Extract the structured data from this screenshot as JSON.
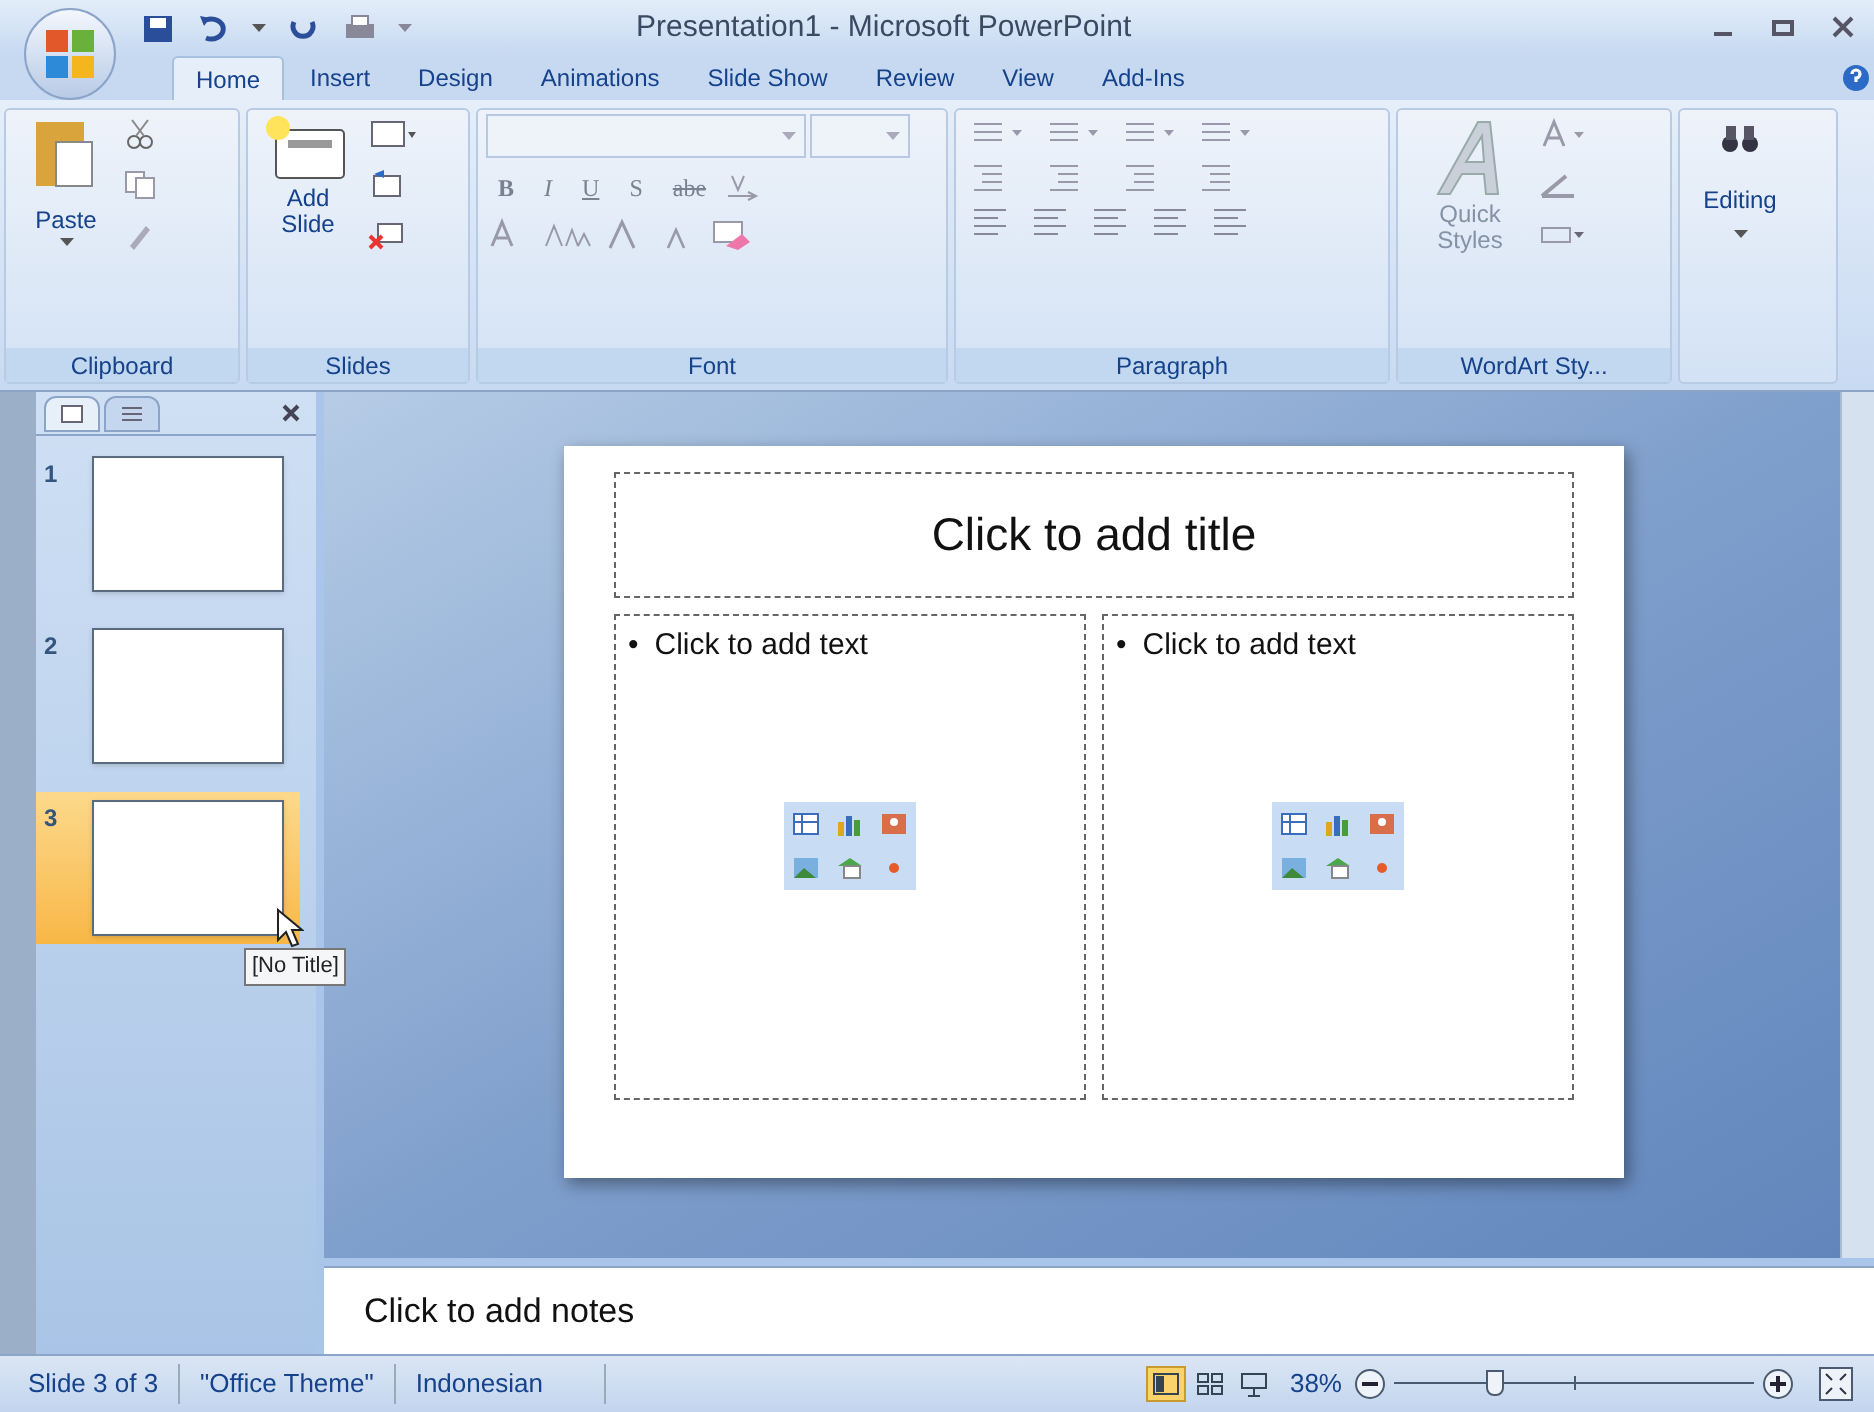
{
  "window": {
    "title": "Presentation1 - Microsoft PowerPoint"
  },
  "tabs": [
    {
      "label": "Home",
      "selected": true
    },
    {
      "label": "Insert",
      "selected": false
    },
    {
      "label": "Design",
      "selected": false
    },
    {
      "label": "Animations",
      "selected": false
    },
    {
      "label": "Slide Show",
      "selected": false
    },
    {
      "label": "Review",
      "selected": false
    },
    {
      "label": "View",
      "selected": false
    },
    {
      "label": "Add-Ins",
      "selected": false
    }
  ],
  "ribbon": {
    "clipboard": {
      "label": "Clipboard",
      "paste": "Paste"
    },
    "slides": {
      "label": "Slides",
      "add_slide": "Add Slide"
    },
    "font": {
      "label": "Font",
      "format_buttons": [
        "B",
        "I",
        "U",
        "S",
        "abe"
      ]
    },
    "paragraph": {
      "label": "Paragraph"
    },
    "wordart": {
      "label": "WordArt Sty...",
      "quick_styles": "Quick Styles"
    },
    "editing": {
      "label": "Editing"
    }
  },
  "thumbnails": [
    {
      "number": "1",
      "selected": false
    },
    {
      "number": "2",
      "selected": false
    },
    {
      "number": "3",
      "selected": true
    }
  ],
  "tooltip": "[No Title]",
  "slide": {
    "title": "Click to add title",
    "placeholders": [
      {
        "bullet": "•",
        "text": "Click to add text"
      },
      {
        "bullet": "•",
        "text": "Click to add text"
      }
    ]
  },
  "notes": "Click to add notes",
  "status_bar": {
    "slide": "Slide 3 of 3",
    "theme": "\"Office Theme\"",
    "language": "Indonesian",
    "views": [
      {
        "kind": "normal",
        "selected": true
      },
      {
        "kind": "sorter",
        "selected": false
      },
      {
        "kind": "show",
        "selected": false
      }
    ],
    "zoom": "38%",
    "zoom_slider": {
      "level": 0.28
    }
  }
}
